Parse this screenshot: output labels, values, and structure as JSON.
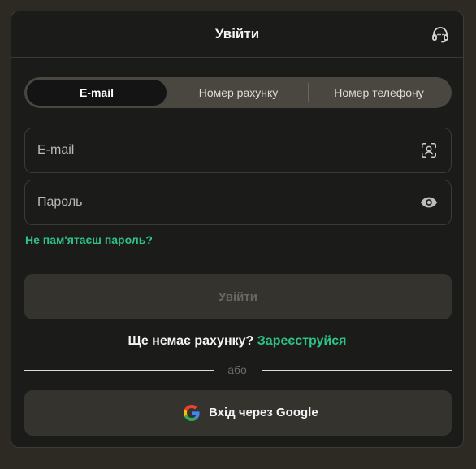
{
  "header": {
    "title": "Увійти",
    "support_icon": "headset-icon"
  },
  "tabs": [
    {
      "label": "E-mail",
      "active": true
    },
    {
      "label": "Номер рахунку",
      "active": false
    },
    {
      "label": "Номер телефону",
      "active": false
    }
  ],
  "form": {
    "email_placeholder": "E-mail",
    "email_value": "",
    "email_icon": "face-id-icon",
    "password_placeholder": "Пароль",
    "password_value": "",
    "password_icon": "eye-icon",
    "forgot_label": "Не пам'ятаєш пароль?",
    "submit_label": "Увійти"
  },
  "signup": {
    "prompt": "Ще немає рахунку?",
    "link": "Зареєструйся"
  },
  "divider": {
    "label": "або"
  },
  "google": {
    "label": "Вхід через Google",
    "icon": "google-icon"
  },
  "colors": {
    "accent": "#2fc285",
    "background": "#1b1b1a",
    "page": "#2d2a24"
  }
}
